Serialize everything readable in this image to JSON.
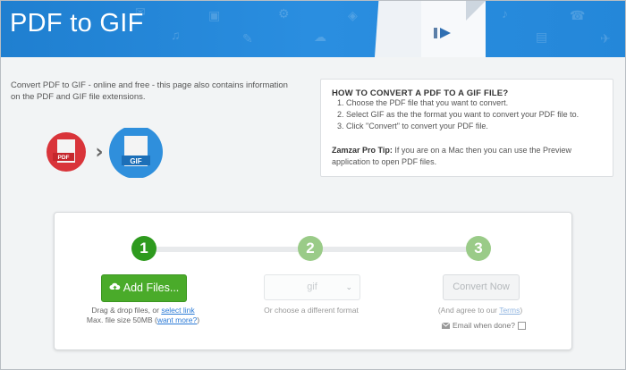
{
  "banner": {
    "title": "PDF to GIF"
  },
  "intro": {
    "text": "Convert PDF to GIF - online and free - this page also contains information on the PDF and GIF file extensions."
  },
  "icons": {
    "from_label": "PDF",
    "to_label": "GIF",
    "arrow": "›"
  },
  "howto": {
    "heading": "HOW TO CONVERT A PDF TO A GIF FILE?",
    "steps": [
      "Choose the PDF file that you want to convert.",
      "Select GIF as the the format you want to convert your PDF file to.",
      "Click \"Convert\" to convert your PDF file."
    ],
    "tip_label": "Zamzar Pro Tip:",
    "tip_text": " If you are on a Mac then you can use the Preview application to open PDF files."
  },
  "converter": {
    "step1": "1",
    "step2": "2",
    "step3": "3",
    "add_files_label": "Add Files...",
    "drag_text": "Drag & drop files, or ",
    "select_link": "select link",
    "max_size_text": "Max. file size 50MB (",
    "want_more": "want more?",
    "close_paren": ")",
    "format_value": "gif",
    "format_hint": "Or choose a different format",
    "convert_label": "Convert Now",
    "agree_text": "(And agree to our ",
    "terms_link": "Terms",
    "agree_close": ")",
    "email_label": "Email when done?"
  },
  "colors": {
    "accent_green": "#4aab2a",
    "banner_blue": "#2487d9",
    "pdf_red": "#d9343a",
    "gif_blue": "#2f8fdc"
  }
}
